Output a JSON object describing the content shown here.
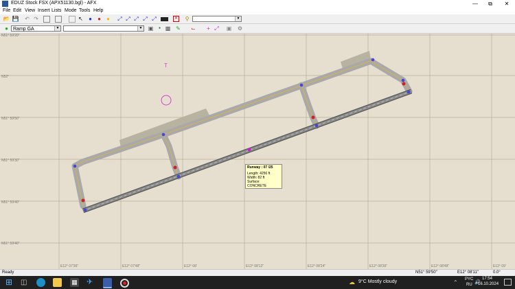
{
  "window": {
    "title": "EDUZ Stock FSX (APX51130.bgl) - AFX",
    "controls": [
      "—",
      "⧉",
      "✕"
    ]
  },
  "menu": [
    "File",
    "Edit",
    "View",
    "Insert",
    "Lists",
    "Mode",
    "Tools",
    "Help"
  ],
  "toolbar2": {
    "ramp_select": "Ramp GA",
    "second_select": ""
  },
  "map": {
    "lat_labels": [
      "N51° 59'20\"",
      "N52°",
      "N51° 59'50\"",
      "N51° 59'30\"",
      "N51° 59'40\"",
      "N51° 59'40\""
    ],
    "lon_labels": [
      "E12° 07'36\"",
      "E12° 07'48\"",
      "E12° 08'",
      "E12° 08'12\"",
      "E12° 08'24\"",
      "E12° 08'36\"",
      "E12° 08'48\"",
      "E12° 09'"
    ],
    "tower_label": "T",
    "tooltip": {
      "runway": "Runway : 07 /25",
      "length": "Length:    4256 ft",
      "width": "Width:     82 ft",
      "surface": "Surface:   CONCRETE"
    }
  },
  "status": {
    "left": "Ready",
    "lat": "N51° 59'50\"",
    "lon": "E12° 08'11\"",
    "heading": "0.0°"
  },
  "taskbar": {
    "weather": "9°C  Mostly cloudy",
    "lang": "PYC",
    "lang2": "RU",
    "time": "17:54",
    "date": "16.10.2024"
  },
  "colors": {
    "accent": "#d00000",
    "node_blue": "#3333cc",
    "node_red": "#cc2222",
    "taxi_fill": "#a8a8a8",
    "runway": "#666666"
  }
}
